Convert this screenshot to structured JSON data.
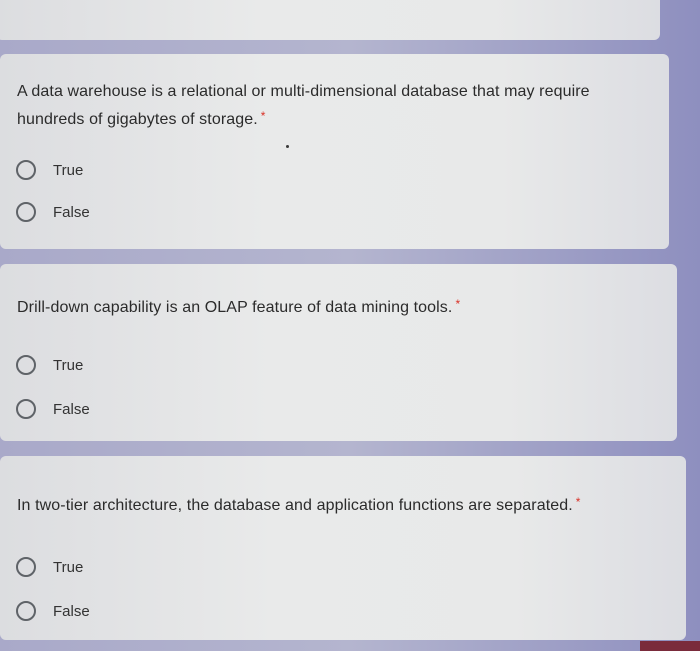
{
  "questions": [
    {
      "text": "A data warehouse is a relational or multi-dimensional database that may require hundreds of gigabytes of storage.",
      "required_mark": "*",
      "options": [
        "True",
        "False"
      ]
    },
    {
      "text": "Drill-down capability is an OLAP feature of data mining tools.",
      "required_mark": "*",
      "options": [
        "True",
        "False"
      ]
    },
    {
      "text": "In two-tier architecture, the database and application functions are separated.",
      "required_mark": "*",
      "options": [
        "True",
        "False"
      ]
    }
  ],
  "colors": {
    "background": "#a9a9c9",
    "card": "#e8e9e9",
    "required": "#d93025",
    "radio_border": "#5f6368"
  }
}
